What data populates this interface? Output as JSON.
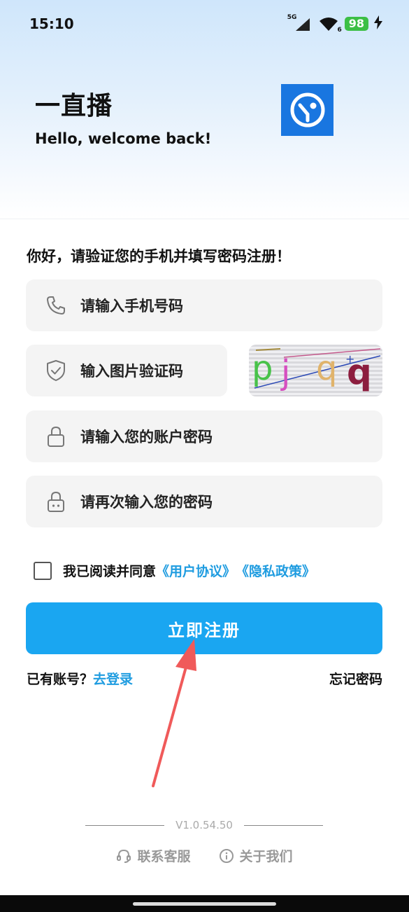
{
  "status_bar": {
    "time": "15:10",
    "network": "5G",
    "wifi_badge": "6",
    "battery": "98"
  },
  "header": {
    "app_name": "一直播",
    "welcome": "Hello, welcome back!",
    "logo_icon": "app-logo-icon"
  },
  "form": {
    "prompt": "你好，请验证您的手机并填写密码注册！",
    "phone_placeholder": "请输入手机号码",
    "captcha_placeholder": "输入图片验证码",
    "captcha_text": "pjqq",
    "password_placeholder": "请输入您的账户密码",
    "confirm_placeholder": "请再次输入您的密码",
    "agree_prefix": "我已阅读并同意",
    "user_agreement": "《用户协议》",
    "privacy_policy": "《隐私政策》",
    "register_button": "立即注册",
    "have_account": "已有账号？",
    "login_link": "去登录",
    "forgot_password": "忘记密码"
  },
  "footer": {
    "version": "V1.0.54.50",
    "contact": "联系客服",
    "about": "关于我们"
  },
  "colors": {
    "accent": "#1aa6f1",
    "link": "#1f9ce0",
    "logo_bg": "#1976e0",
    "battery": "#3cbf45",
    "annotation_arrow": "#f05a5a"
  }
}
